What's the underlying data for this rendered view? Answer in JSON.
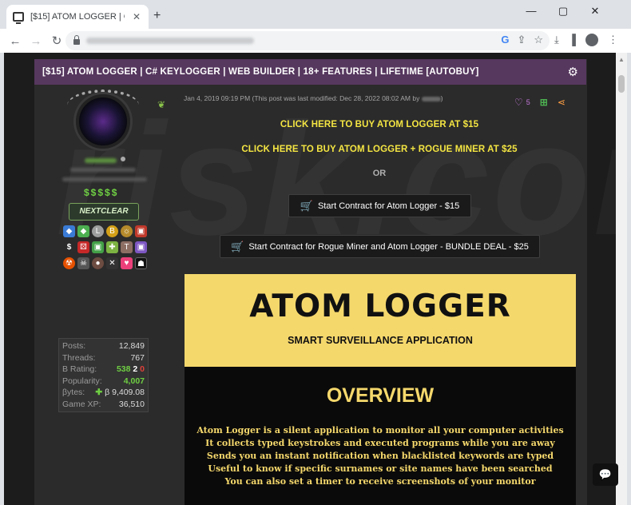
{
  "browser": {
    "tab_title": "[$15] ATOM LOGGER | C# KEYLO",
    "tab_close": "✕",
    "new_tab": "+",
    "minimize": "—",
    "maximize": "▢",
    "close": "✕"
  },
  "toolbar": {
    "back": "←",
    "forward": "→",
    "reload": "↻",
    "google": "G",
    "share": "⇪",
    "bookmark": "☆",
    "download": "⤓",
    "sidepanel": "▐",
    "menu": "⋮"
  },
  "thread": {
    "title": "[$15] ATOM LOGGER | C# KEYLOGGER | WEB BUILDER | 18+ FEATURES | LIFETIME [AUTOBUY]",
    "settings_icon": "⚙"
  },
  "post": {
    "meta_prefix": "Jan 4, 2019 09:19 PM",
    "meta_modified": "(This post was last modified: Dec 28, 2022 08:02 AM by",
    "meta_suffix": ")",
    "like_count": "5",
    "buy_atom": "CLICK HERE TO BUY ATOM LOGGER AT $15",
    "buy_bundle": "CLICK HERE TO BUY ATOM LOGGER + ROGUE MINER AT $25",
    "or": "OR",
    "contract_atom": "Start Contract for Atom Logger - $15",
    "contract_bundle": "Start Contract for Rogue Miner and Atom Logger - BUNDLE DEAL - $25"
  },
  "banner": {
    "title": "ATOM LOGGER",
    "subtitle": "SMART SURVEILLANCE APPLICATION",
    "overview": "OVERVIEW",
    "lines": [
      "Atom Logger is a silent application to monitor all your computer activities",
      "It collects typed keystrokes and executed programs while you are away",
      "Sends you an instant notification when blacklisted keywords are typed",
      "Useful to know if specific surnames or site names have been searched",
      "You can also set a timer to receive screenshots of your monitor"
    ]
  },
  "user": {
    "dollars": "$$$$$",
    "userbar": "NEXTCLEAR",
    "stats": [
      {
        "label": "Posts:",
        "value": "12,849"
      },
      {
        "label": "Threads:",
        "value": "767"
      },
      {
        "label": "B Rating:",
        "value": ""
      },
      {
        "label": "Popularity:",
        "value": "4,007"
      },
      {
        "label": "βytes:",
        "value": "β 9,409.08"
      },
      {
        "label": "Game XP:",
        "value": "36,510"
      }
    ],
    "rating_pos": "538",
    "rating_neu": "2",
    "rating_neg": "0"
  },
  "watermark": "risk.com",
  "colors": {
    "header_purple": "#56375e",
    "link_yellow": "#f4e542",
    "banner_yellow": "#f5d86c"
  }
}
